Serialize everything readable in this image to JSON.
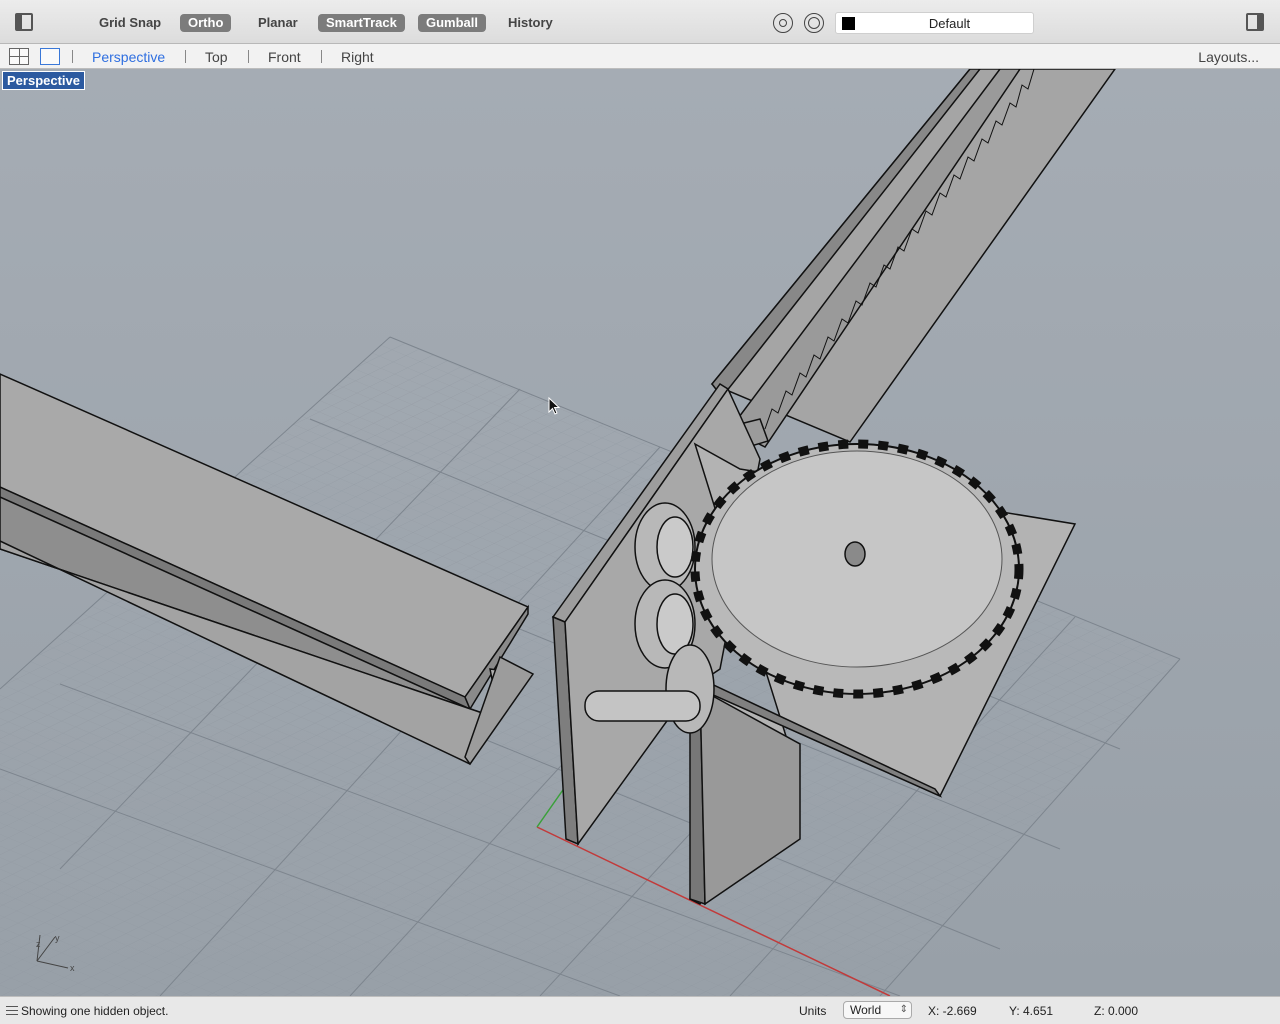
{
  "toolbar": {
    "buttons": [
      {
        "label": "Grid Snap",
        "on": false
      },
      {
        "label": "Ortho",
        "on": true
      },
      {
        "label": "Planar",
        "on": false
      },
      {
        "label": "SmartTrack",
        "on": true
      },
      {
        "label": "Gumball",
        "on": true
      },
      {
        "label": "History",
        "on": false
      }
    ],
    "layer_name": "Default",
    "layer_color": "#000000"
  },
  "tabs": {
    "items": [
      "Perspective",
      "Top",
      "Front",
      "Right"
    ],
    "active": "Perspective",
    "layouts_label": "Layouts..."
  },
  "viewport": {
    "label": "Perspective",
    "axis_labels": [
      "z",
      "y",
      "x"
    ]
  },
  "status": {
    "message": "Showing one hidden object.",
    "units_label": "Units",
    "units_value": "World",
    "x": "X: -2.669",
    "y": "Y: 4.651",
    "z": "Z: 0.000"
  },
  "colors": {
    "active_tab": "#2f6fe0",
    "viewport_label_bg": "#2c5aa0",
    "toggle_on_bg": "#7c7c7c",
    "x_axis": "#c23a3a",
    "y_axis": "#3aa03a"
  }
}
